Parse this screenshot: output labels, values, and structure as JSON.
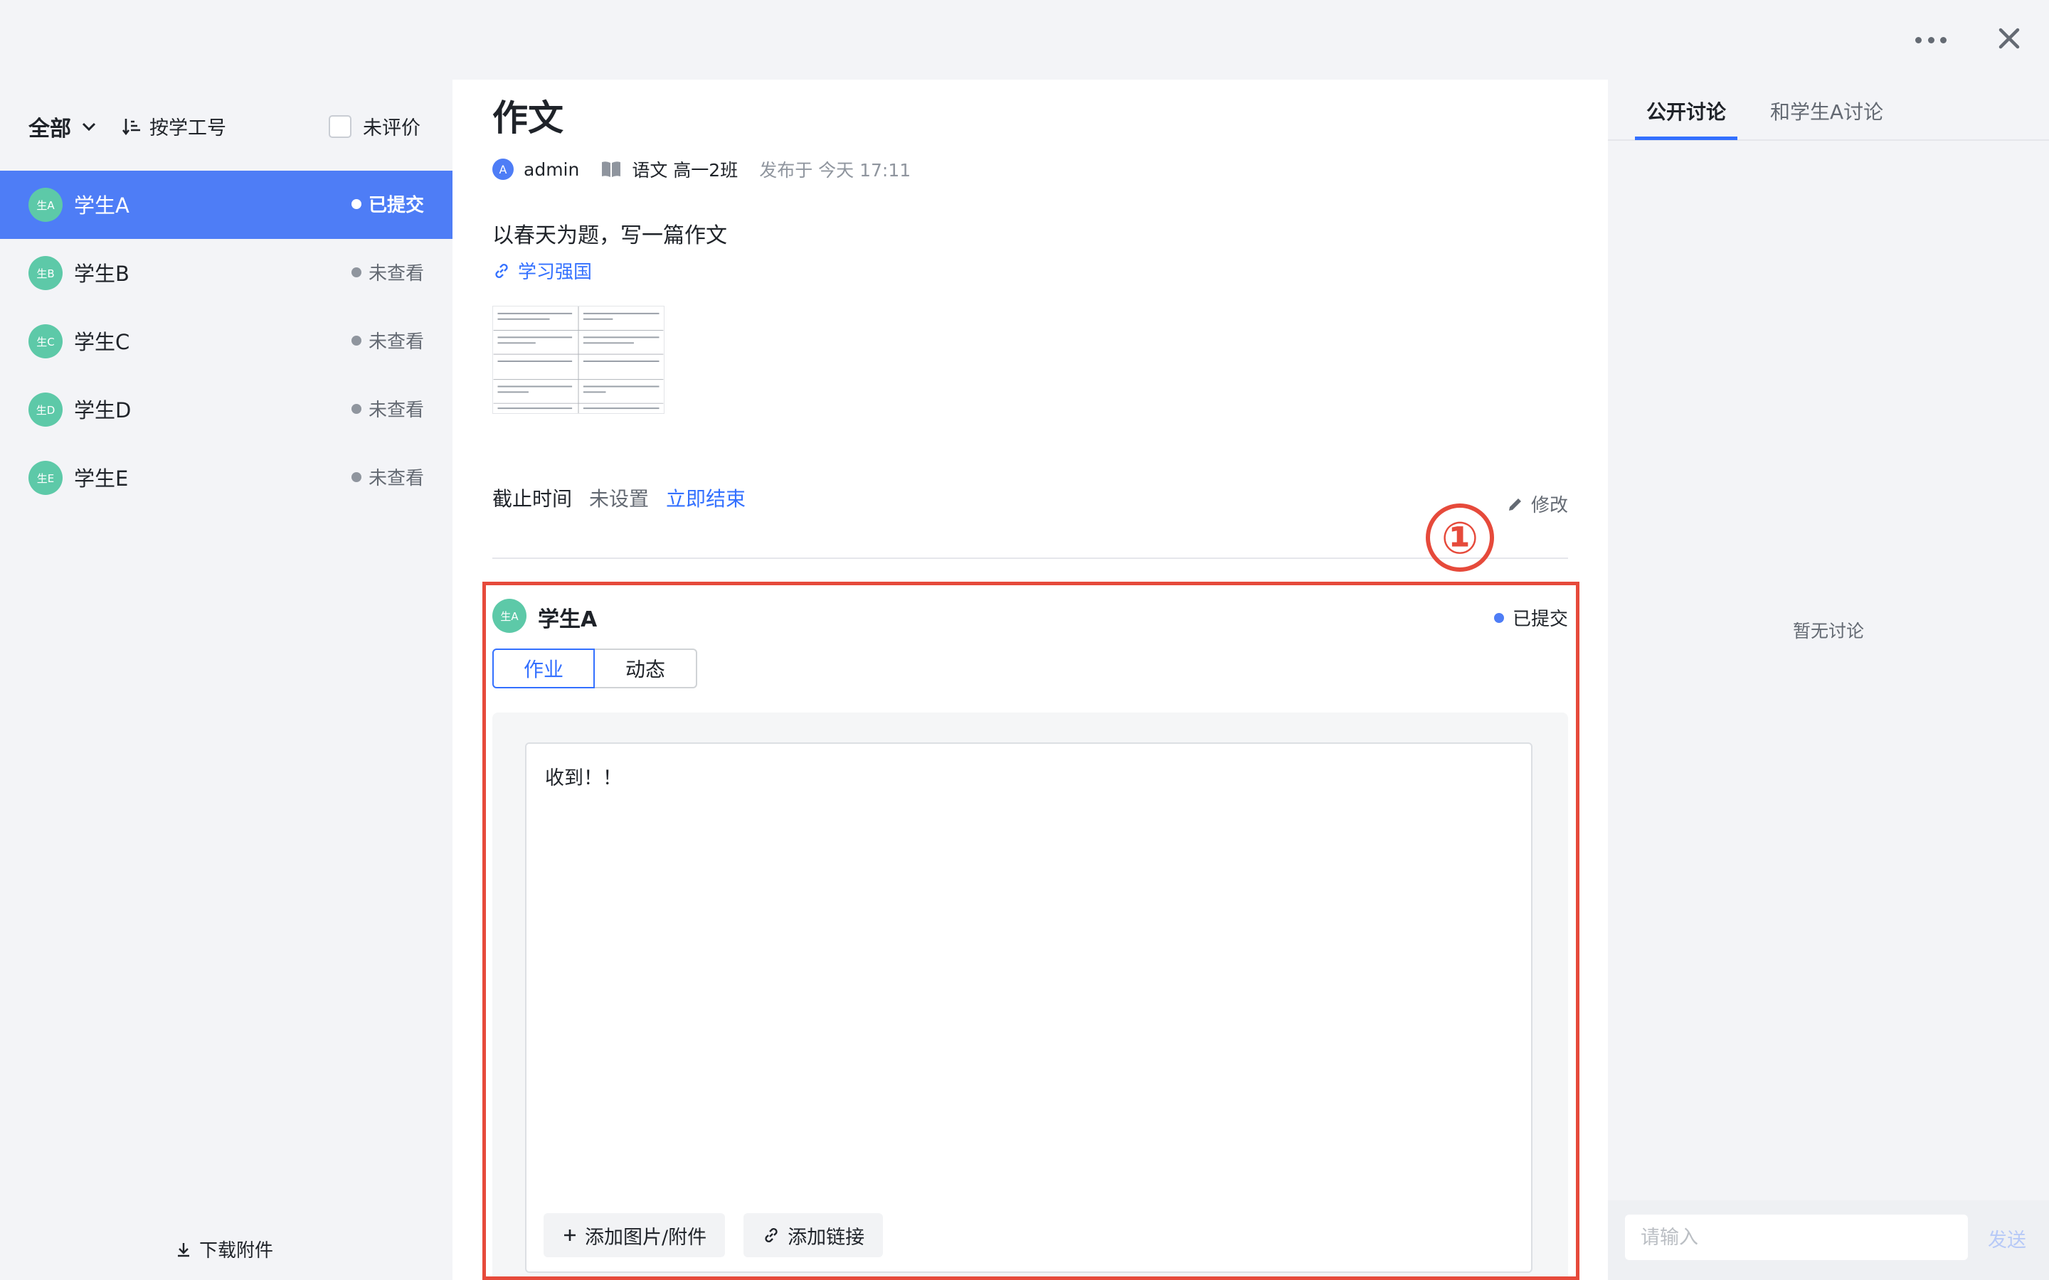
{
  "topbar": {
    "more_icon": "more-horizontal-icon",
    "close_icon": "close-icon"
  },
  "left": {
    "filter_all": "全部",
    "sort_label": "按学工号",
    "unrated_label": "未评价",
    "students": [
      {
        "avatar": "生A",
        "name": "学生A",
        "status": "已提交",
        "active": true
      },
      {
        "avatar": "生B",
        "name": "学生B",
        "status": "未查看",
        "active": false
      },
      {
        "avatar": "生C",
        "name": "学生C",
        "status": "未查看",
        "active": false
      },
      {
        "avatar": "生D",
        "name": "学生D",
        "status": "未查看",
        "active": false
      },
      {
        "avatar": "生E",
        "name": "学生E",
        "status": "未查看",
        "active": false
      }
    ],
    "download_label": "下载附件"
  },
  "main": {
    "title": "作文",
    "author_avatar": "A",
    "author": "admin",
    "course": "语文 高一2班",
    "published": "发布于 今天 17:11",
    "description": "以春天为题，写一篇作文",
    "link_label": "学习强国",
    "deadline_label": "截止时间",
    "deadline_value": "未设置",
    "end_now_label": "立即结束",
    "edit_label": "修改",
    "annotation_marker": "①",
    "submission": {
      "avatar": "生A",
      "name": "学生A",
      "status": "已提交",
      "tabs": [
        "作业",
        "动态"
      ],
      "content": "收到！！",
      "add_attachment_label": "添加图片/附件",
      "add_link_label": "添加链接"
    }
  },
  "right": {
    "tabs": [
      "公开讨论",
      "和学生A讨论"
    ],
    "empty_text": "暂无讨论",
    "input_placeholder": "请输入",
    "send_label": "发送"
  },
  "colors": {
    "accent": "#4e7df6",
    "link": "#3370ff",
    "avatar": "#5dc9a8",
    "annotation": "#e64a3b"
  }
}
